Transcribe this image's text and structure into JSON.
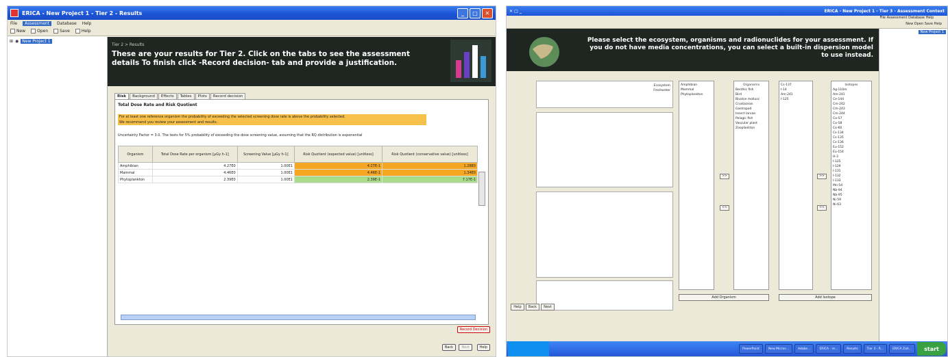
{
  "left": {
    "window_title": "ERICA - New Project 1 - Tier 2 - Results",
    "menu": [
      "File",
      "Assessment",
      "Database",
      "Help"
    ],
    "toolbar": [
      "New",
      "Open",
      "Save",
      "Help"
    ],
    "tree_root": "New Project 1",
    "breadcrumb": "Tier 2 > Results",
    "banner_message": "These are your results for Tier 2. Click on the tabs to see the assessment details To finish click -Record decision- tab and provide a justification.",
    "tabs": [
      "Risk",
      "Background",
      "Effects",
      "Tables",
      "Plots",
      "Record decision"
    ],
    "section_title": "Total Dose Rate and Risk Quotient",
    "warning_line1": "For at least one reference organism the probability of exceeding the selected screening dose rate is above the probability selected.",
    "warning_line2": "We recommend you review your assessment and results.",
    "uncertainty_text": "Uncertainty Factor = 3.0. The tests for 5% probability of exceeding the dose screening value, assuming that the RQ distribution is exponential",
    "table": {
      "headers": [
        "Organism",
        "Total Dose Rate per organism [µGy h-1]",
        "Screening Value [µGy h-1]",
        "Risk Quotient (expected value) [unitless]",
        "Risk Quotient (conservative value) [unitless]"
      ],
      "rows": [
        {
          "organism": "Amphibian",
          "dose": "4.27E0",
          "screen": "1.00E1",
          "rq_exp": "4.27E-1",
          "rq_cons": "1.28E0"
        },
        {
          "organism": "Mammal",
          "dose": "4.46E0",
          "screen": "1.00E1",
          "rq_exp": "4.46E-1",
          "rq_cons": "1.34E0"
        },
        {
          "organism": "Phytoplankton",
          "dose": "2.39E0",
          "screen": "1.00E1",
          "rq_exp": "2.39E-1",
          "rq_cons": "7.17E-1"
        }
      ]
    },
    "buttons": {
      "record": "Record Decision",
      "back": "Back",
      "next": "Next",
      "help": "Help"
    }
  },
  "right": {
    "window_title": "ERICA - New Project 1 - Tier 3 - Assessment Context",
    "menu": "File  Assessment  Database  Help",
    "toolbar": "New  Open  Save  Help",
    "tree_root": "New Project 1",
    "banner_message": "Please select the ecosystem, organisms and radionuclides for your assessment. If you do not have media concentrations, you can select a built-in dispersion model to use instead.",
    "isotopes_head": "Isotopes",
    "isotopes_available": [
      "Ag-110m",
      "Am-241",
      "Ce-144",
      "Cm-242",
      "Cm-243",
      "Cm-244",
      "Co-57",
      "Co-58",
      "Co-60",
      "Cs-134",
      "Cs-135",
      "Cs-136",
      "Eu-152",
      "Eu-154",
      "H-3",
      "I-125",
      "I-129",
      "I-131",
      "I-132",
      "I-133",
      "Mn-54",
      "Nb-94",
      "Nb-95",
      "Ni-59",
      "Ni-63"
    ],
    "isotopes_selected": [
      "Cs-137",
      "I-14",
      "Am-241",
      "I-125"
    ],
    "organisms_head": "Organisms",
    "organisms_available": [
      "Benthic fish",
      "Bird",
      "Bivalve mollusc",
      "Crustacean",
      "Gastropod",
      "Insect larvae",
      "Pelagic fish",
      "Vascular plant",
      "Zooplankton"
    ],
    "organisms_selected": [
      "Amphibian",
      "Mammal",
      "Phytoplankton"
    ],
    "ecosystem_head": "Ecosystem",
    "ecosystem_value": "Freshwater",
    "add_isotope": "Add Isotope",
    "add_organism": "Add Organism",
    "buttons": [
      "Help",
      "Back",
      "Next"
    ],
    "taskbar": [
      "start",
      "ERICA Zah...",
      "Tier 3 - R...",
      "Results",
      "ERICA - re...",
      "Adobe...",
      "New Micros...",
      "PowerPoint"
    ]
  }
}
